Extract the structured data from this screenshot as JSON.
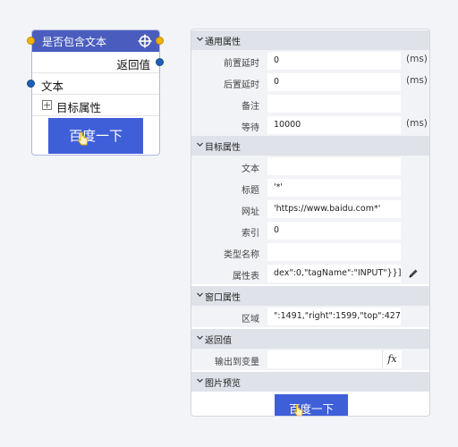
{
  "node": {
    "title": "是否包含文本",
    "icon": "crosshair-icon",
    "output_label": "返回值",
    "input_label": "文本",
    "group_label": "目标属性",
    "expand_symbol": "+",
    "preview_text": "百度一下"
  },
  "panel": {
    "general": {
      "title": "通用属性",
      "rows": [
        {
          "label": "前置延时",
          "value": "0",
          "unit": "(ms)"
        },
        {
          "label": "后置延时",
          "value": "0",
          "unit": "(ms)"
        },
        {
          "label": "备注",
          "value": "",
          "unit": ""
        },
        {
          "label": "等待",
          "value": "10000",
          "unit": "(ms)"
        }
      ]
    },
    "target": {
      "title": "目标属性",
      "rows": [
        {
          "label": "文本",
          "value": ""
        },
        {
          "label": "标题",
          "value": "'*'"
        },
        {
          "label": "网址",
          "value": "'https://www.baidu.com*'"
        },
        {
          "label": "索引",
          "value": "0"
        },
        {
          "label": "类型名称",
          "value": ""
        },
        {
          "label": "属性表",
          "value": "dex\":0,\"tagName\":\"INPUT\"}}]}"
        }
      ]
    },
    "window": {
      "title": "窗口属性",
      "rows": [
        {
          "label": "区域",
          "value": "\":1491,\"right\":1599,\"top\":427}"
        }
      ]
    },
    "return": {
      "title": "返回值",
      "rows": [
        {
          "label": "输出到变量",
          "value": "",
          "fx": "fx"
        }
      ]
    },
    "preview": {
      "title": "图片预览",
      "button_text": "百度一下"
    }
  },
  "colors": {
    "accent": "#4a5dbe",
    "port_yellow": "#f0b400",
    "port_blue": "#1f5fb5",
    "section_bg": "#dfe2e8",
    "preview_blue": "#3f5fd9"
  }
}
